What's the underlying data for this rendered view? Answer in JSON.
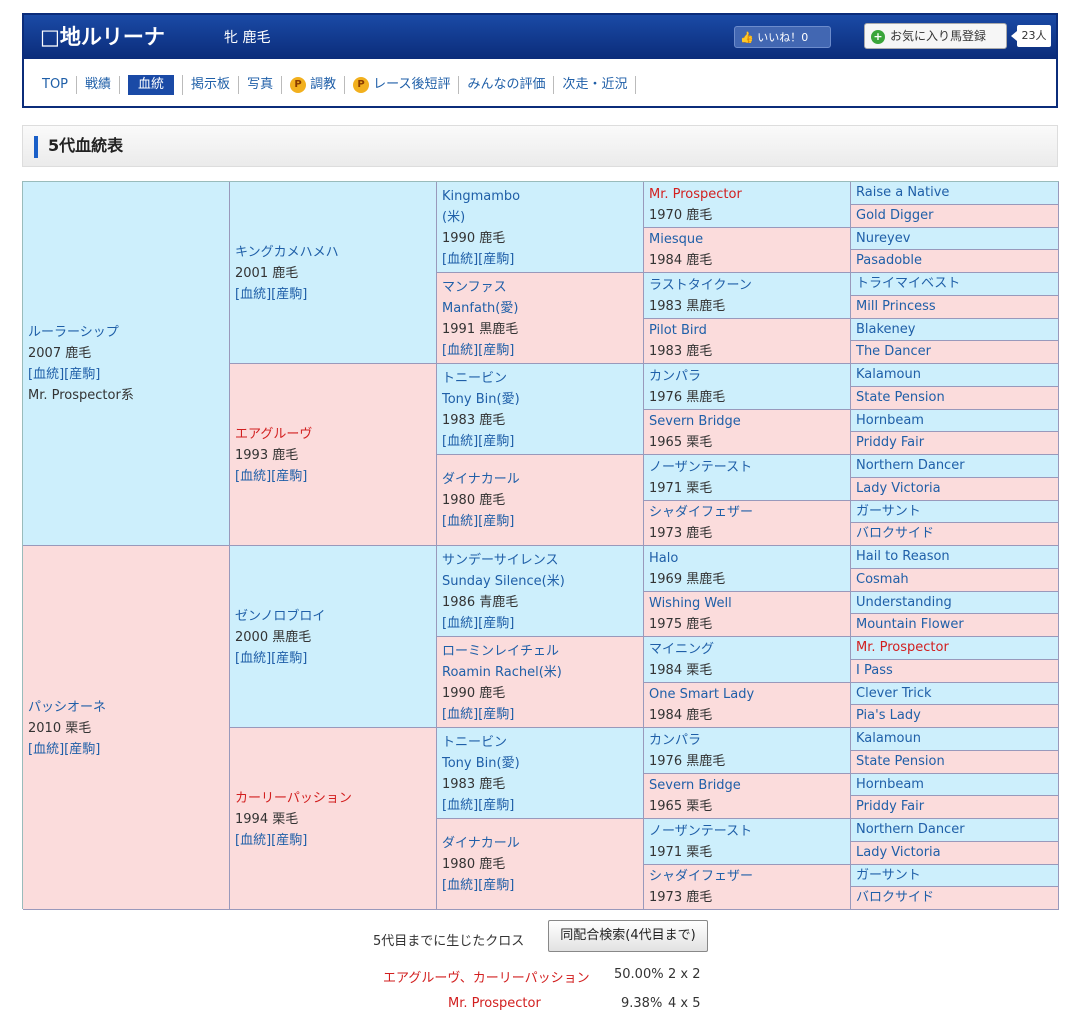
{
  "horse": {
    "name": "□地ルリーナ",
    "sex_color": "牝 鹿毛",
    "like_label": "いいね！0",
    "fav_label": "お気に入り馬登録",
    "fav_count": "23人"
  },
  "nav": [
    "TOP",
    "戦績",
    "血統",
    "掲示板",
    "写真",
    "調教",
    "レース後短評",
    "みんなの評価",
    "次走・近況"
  ],
  "section_title": "5代血統表",
  "links": {
    "pedigree": "[血統]",
    "offspring": "[産駒]"
  },
  "gen1": [
    {
      "name": "ルーラーシップ",
      "info": "2007 鹿毛",
      "line": "Mr. Prospector系"
    },
    {
      "name": "パッシオーネ",
      "info": "2010 栗毛"
    }
  ],
  "gen2": [
    {
      "name": "キングカメハメハ",
      "info": "2001 鹿毛"
    },
    {
      "name": "エアグルーヴ",
      "info": "1993 鹿毛"
    },
    {
      "name": "ゼンノロブロイ",
      "info": "2000 黒鹿毛"
    },
    {
      "name": "カーリーパッション",
      "info": "1994 栗毛"
    }
  ],
  "gen3": [
    {
      "name": "Kingmambo",
      "name2": "(米)",
      "info": "1990 鹿毛"
    },
    {
      "name": "マンファス",
      "name2": "Manfath(愛)",
      "info": "1991 黒鹿毛"
    },
    {
      "name": "トニービン",
      "name2": "Tony Bin(愛)",
      "info": "1983 鹿毛"
    },
    {
      "name": "ダイナカール",
      "name2": "",
      "info": "1980 鹿毛"
    },
    {
      "name": "サンデーサイレンス",
      "name2": "Sunday Silence(米)",
      "info": "1986 青鹿毛"
    },
    {
      "name": "ローミンレイチェル",
      "name2": "Roamin Rachel(米)",
      "info": "1990 鹿毛"
    },
    {
      "name": "トニービン",
      "name2": "Tony Bin(愛)",
      "info": "1983 鹿毛"
    },
    {
      "name": "ダイナカール",
      "name2": "",
      "info": "1980 鹿毛"
    }
  ],
  "gen4": [
    {
      "name": "Mr. Prospector",
      "info": "1970 鹿毛"
    },
    {
      "name": "Miesque",
      "info": "1984 鹿毛"
    },
    {
      "name": "ラストタイクーン",
      "info": "1983 黒鹿毛"
    },
    {
      "name": "Pilot Bird",
      "info": "1983 鹿毛"
    },
    {
      "name": "カンパラ",
      "info": "1976 黒鹿毛"
    },
    {
      "name": "Severn Bridge",
      "info": "1965 栗毛"
    },
    {
      "name": "ノーザンテースト",
      "info": "1971 栗毛"
    },
    {
      "name": "シャダイフェザー",
      "info": "1973 鹿毛"
    },
    {
      "name": "Halo",
      "info": "1969 黒鹿毛"
    },
    {
      "name": "Wishing Well",
      "info": "1975 鹿毛"
    },
    {
      "name": "マイニング",
      "info": "1984 栗毛"
    },
    {
      "name": "One Smart Lady",
      "info": "1984 鹿毛"
    },
    {
      "name": "カンパラ",
      "info": "1976 黒鹿毛"
    },
    {
      "name": "Severn Bridge",
      "info": "1965 栗毛"
    },
    {
      "name": "ノーザンテースト",
      "info": "1971 栗毛"
    },
    {
      "name": "シャダイフェザー",
      "info": "1973 鹿毛"
    }
  ],
  "gen5": [
    "Raise a Native",
    "Gold Digger",
    "Nureyev",
    "Pasadoble",
    "トライマイベスト",
    "Mill Princess",
    "Blakeney",
    "The Dancer",
    "Kalamoun",
    "State Pension",
    "Hornbeam",
    "Priddy Fair",
    "Northern Dancer",
    "Lady Victoria",
    "ガーサント",
    "バロクサイド",
    "Hail to Reason",
    "Cosmah",
    "Understanding",
    "Mountain Flower",
    "Mr. Prospector",
    "I Pass",
    "Clever Trick",
    "Pia's Lady",
    "Kalamoun",
    "State Pension",
    "Hornbeam",
    "Priddy Fair",
    "Northern Dancer",
    "Lady Victoria",
    "ガーサント",
    "バロクサイド"
  ],
  "cross": {
    "label": "5代目までに生じたクロス",
    "button": "同配合検索(4代目まで)",
    "rows": [
      {
        "name": "エアグルーヴ、カーリーパッション",
        "pct": "50.00%",
        "gen": "2 x 2"
      },
      {
        "name": "Mr. Prospector",
        "pct": "9.38%",
        "gen": "4 x 5"
      }
    ]
  }
}
